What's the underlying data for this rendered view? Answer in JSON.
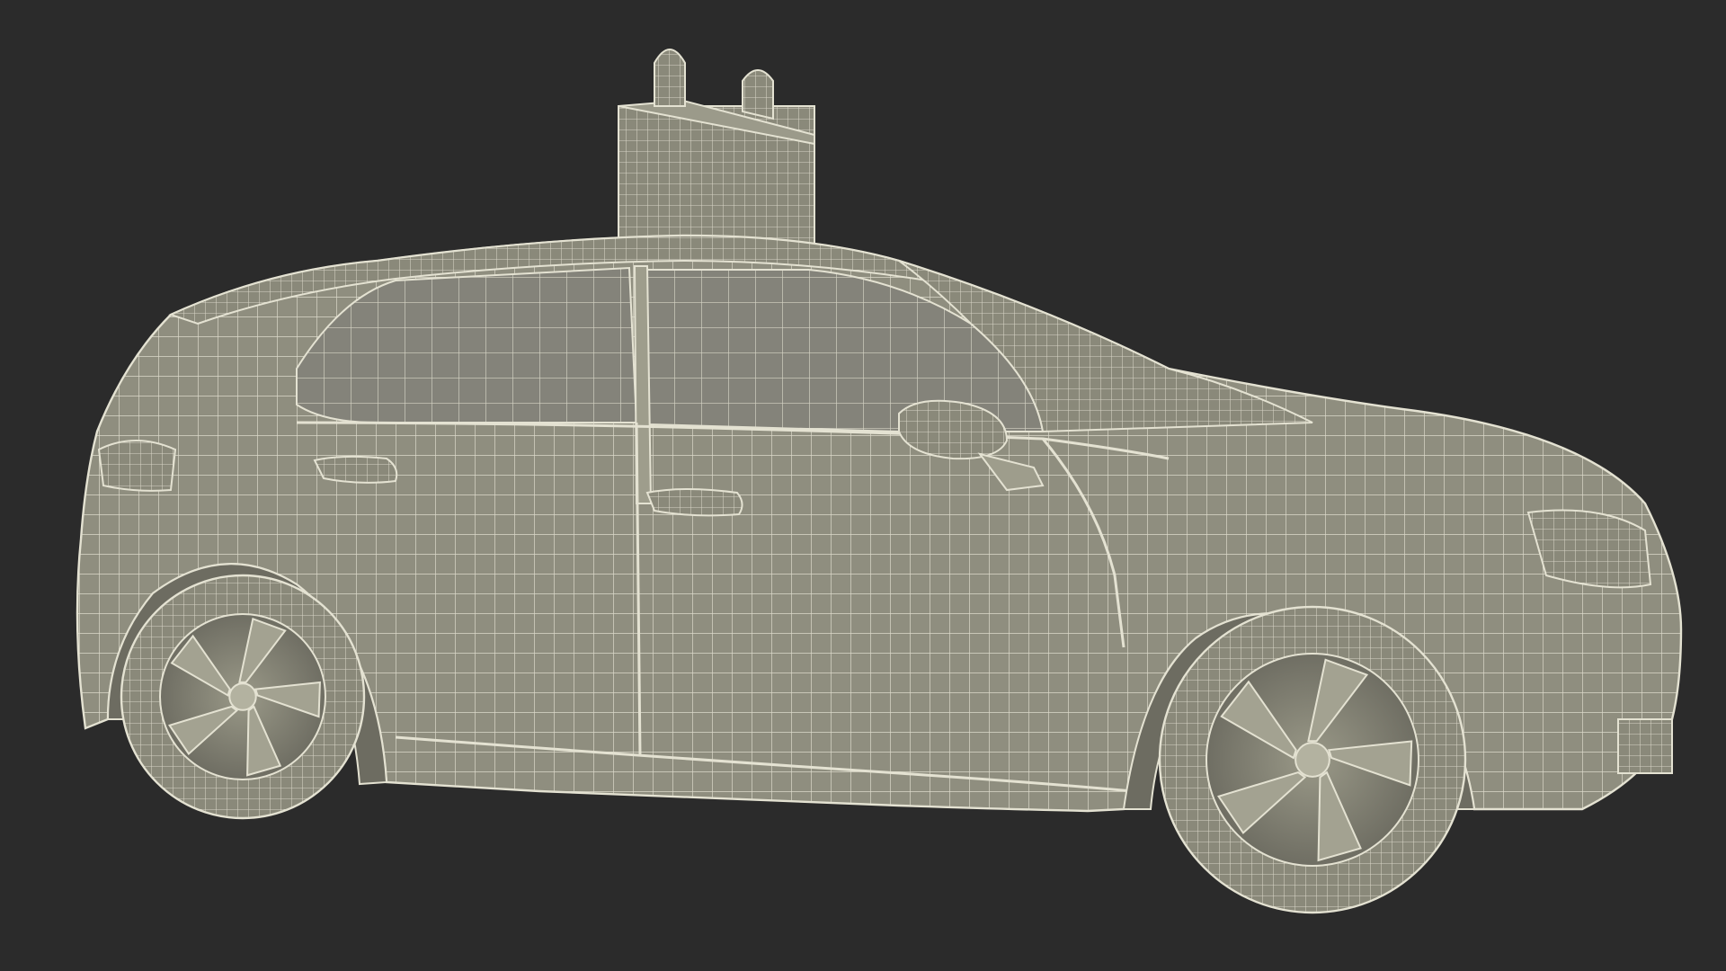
{
  "scene": {
    "background": "#2b2b2b",
    "mesh_fill": "#8f8e7f",
    "mesh_line": "#e4e2d2",
    "shadow": "#55554b"
  },
  "icons": {
    "car": "car-wireframe-icon",
    "sensor": "roof-sensor-icon",
    "wheel": "wheel-icon"
  }
}
